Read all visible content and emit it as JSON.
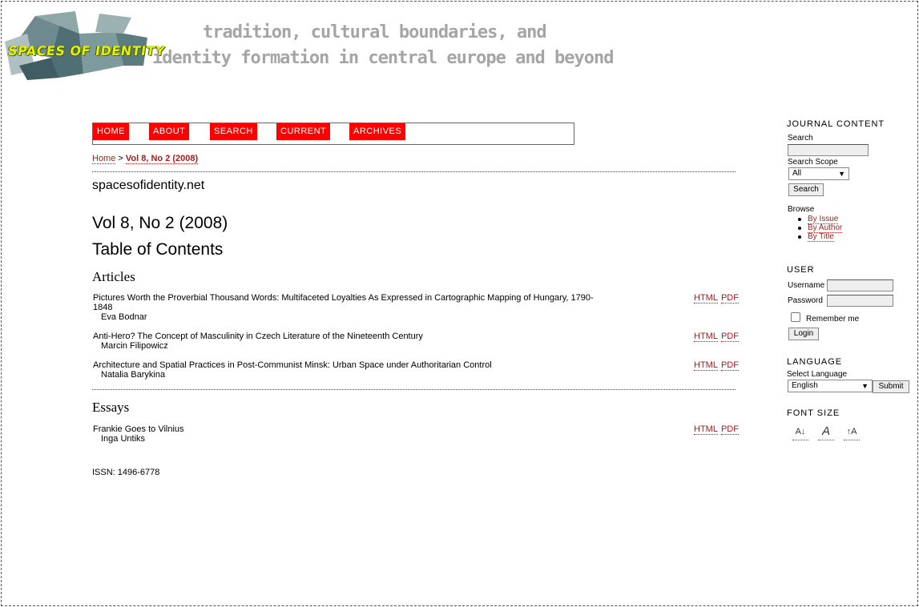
{
  "header": {
    "logo_text": "SPACES OF IDENTITY",
    "tagline_line1": "tradition, cultural boundaries, and",
    "tagline_line2": "identity formation in central europe and beyond"
  },
  "nav": {
    "items": [
      "HOME",
      "ABOUT",
      "SEARCH",
      "CURRENT",
      "ARCHIVES"
    ]
  },
  "breadcrumb": {
    "home": "Home",
    "separator": ">",
    "current": "Vol 8, No 2 (2008)"
  },
  "main": {
    "site_name": "spacesofidentity.net",
    "issue_title": "Vol 8, No 2 (2008)",
    "toc_title": "Table of Contents",
    "sections": [
      {
        "title": "Articles",
        "articles": [
          {
            "title": "Pictures Worth the Proverbial Thousand Words: Multifaceted Loyalties As Expressed in Cartographic Mapping of Hungary, 1790-1848",
            "author": "Eva Bodnar",
            "galleys": [
              "HTML",
              "PDF"
            ]
          },
          {
            "title": "Anti-Hero? The Concept of Masculinity in Czech Literature of the Nineteenth Century",
            "author": "Marcin Filipowicz",
            "galleys": [
              "HTML",
              "PDF"
            ]
          },
          {
            "title": "Architecture and Spatial Practices in Post-Communist Minsk: Urban Space under Authoritarian Control",
            "author": "Natalia Barykina",
            "galleys": [
              "HTML",
              "PDF"
            ]
          }
        ]
      },
      {
        "title": "Essays",
        "articles": [
          {
            "title": "Frankie Goes to Vilnius",
            "author": "Inga Untiks",
            "galleys": [
              "HTML",
              "PDF"
            ]
          }
        ]
      }
    ],
    "issn": "ISSN: 1496-6778"
  },
  "sidebar": {
    "journal_content": {
      "heading": "JOURNAL CONTENT",
      "search_label": "Search",
      "search_value": "",
      "scope_label": "Search Scope",
      "scope_value": "All",
      "search_button": "Search",
      "browse_label": "Browse",
      "browse_links": [
        "By Issue",
        "By Author",
        "By Title"
      ]
    },
    "user": {
      "heading": "USER",
      "username_label": "Username",
      "password_label": "Password",
      "remember_label": "Remember me",
      "login_button": "Login"
    },
    "language": {
      "heading": "LANGUAGE",
      "select_label": "Select Language",
      "selected": "English",
      "submit_button": "Submit"
    },
    "font_size": {
      "heading": "FONT SIZE",
      "buttons": [
        "A↓",
        "A",
        "↑A"
      ]
    }
  },
  "colors": {
    "nav_bg": "#ff0000",
    "link": "#a02020",
    "tagline": "#a5a5a5",
    "logo_text": "#e6f000"
  }
}
